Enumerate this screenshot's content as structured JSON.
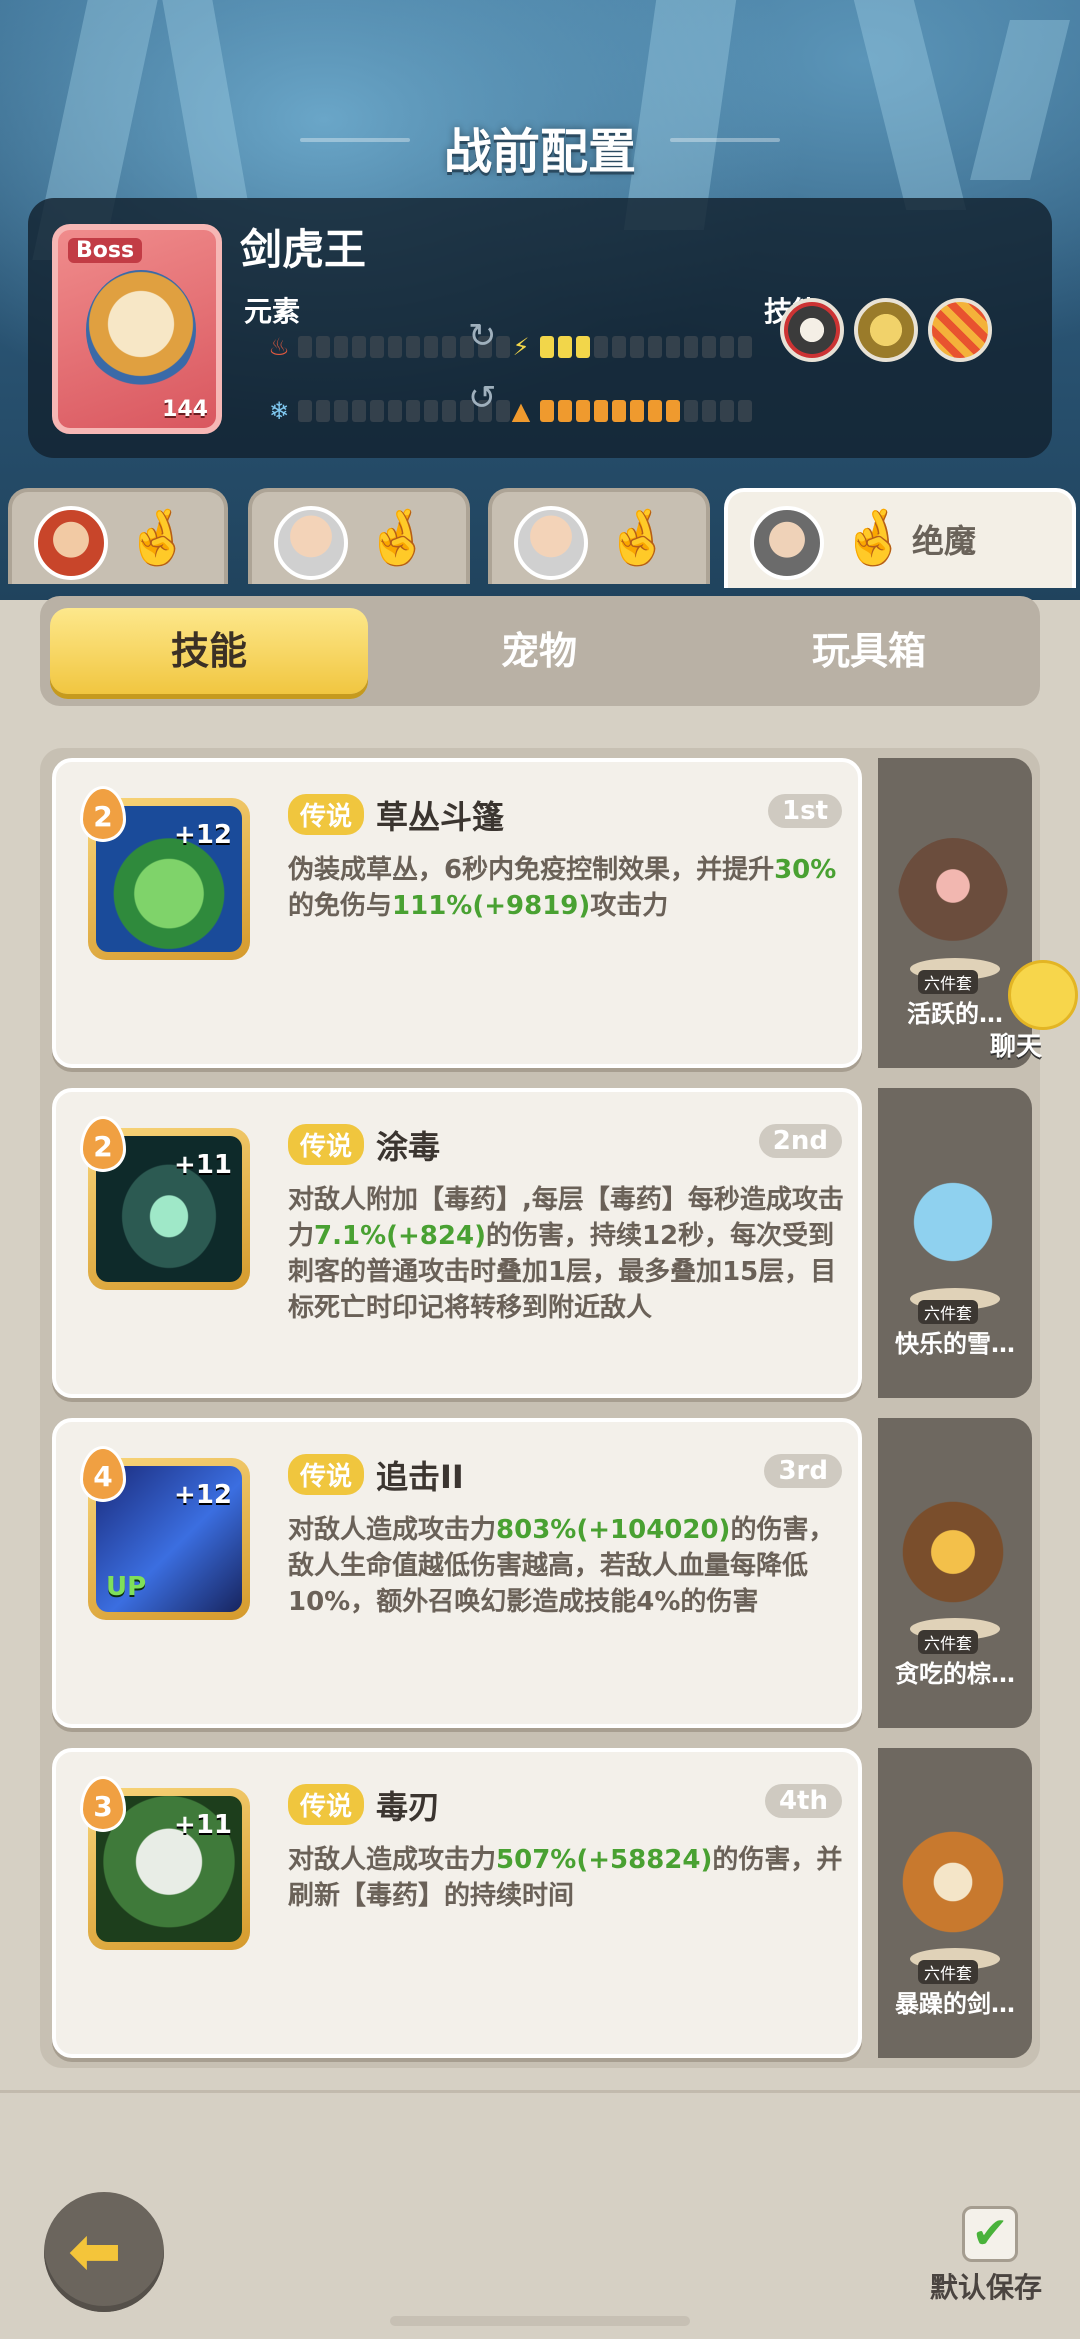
{
  "header": {
    "title": "战前配置"
  },
  "boss": {
    "tag": "Boss",
    "name": "剑虎王",
    "level": "144",
    "element_label": "元素",
    "skills_label": "技能",
    "elements": [
      {
        "icon": "fire-icon",
        "filled": 0,
        "total": 12,
        "color": "#e35a3f"
      },
      {
        "icon": "lightning-icon",
        "filled": 3,
        "total": 12,
        "color": "#f2d64a"
      },
      {
        "icon": "snowflake-icon",
        "filled": 0,
        "total": 12,
        "color": "#7fc7ef"
      },
      {
        "icon": "earth-icon",
        "filled": 8,
        "total": 12,
        "color": "#ef9a2e"
      }
    ]
  },
  "hero_tabs": [
    {
      "label": ""
    },
    {
      "label": ""
    },
    {
      "label": ""
    },
    {
      "label": "绝魔"
    }
  ],
  "category_tabs": {
    "skills": "技能",
    "pets": "宠物",
    "toybox": "玩具箱"
  },
  "skills": [
    {
      "rank": "2",
      "plus": "+12",
      "rarity": "传说",
      "name": "草丛斗篷",
      "order": "1st",
      "desc": [
        "伪装成草丛，6秒内免疫控制效果，并提升",
        {
          "g": "30%"
        },
        "的免伤与",
        {
          "g": "111%(+9819)"
        },
        "攻击力"
      ],
      "pet_name": "活跃的…",
      "pet_tag": "六件套"
    },
    {
      "rank": "2",
      "plus": "+11",
      "rarity": "传说",
      "name": "涂毒",
      "order": "2nd",
      "desc": [
        "对敌人附加【毒药】,每层【毒药】每秒造成攻击力",
        {
          "g": "7.1%(+824)"
        },
        "的伤害，持续12秒，每次受到刺客的普通攻击时叠加1层，最多叠加15层，目标死亡时印记将转移到附近敌人"
      ],
      "pet_name": "快乐的雪…",
      "pet_tag": "六件套"
    },
    {
      "rank": "4",
      "plus": "+12",
      "up": "UP",
      "rarity": "传说",
      "name": "追击II",
      "order": "3rd",
      "desc": [
        "对敌人造成攻击力",
        {
          "g": "803%(+104020)"
        },
        "的伤害，敌人生命值越低伤害越高，若敌人血量每降低10%，额外召唤幻影造成技能4%的伤害"
      ],
      "pet_name": "贪吃的棕…",
      "pet_tag": "六件套"
    },
    {
      "rank": "3",
      "plus": "+11",
      "rarity": "传说",
      "name": "毒刃",
      "order": "4th",
      "desc": [
        "对敌人造成攻击力",
        {
          "g": "507%(+58824)"
        },
        "的伤害，并刷新【毒药】的持续时间"
      ],
      "pet_name": "暴躁的剑…",
      "pet_tag": "六件套"
    }
  ],
  "chat": {
    "label": "聊天"
  },
  "footer": {
    "save_label": "默认保存"
  }
}
